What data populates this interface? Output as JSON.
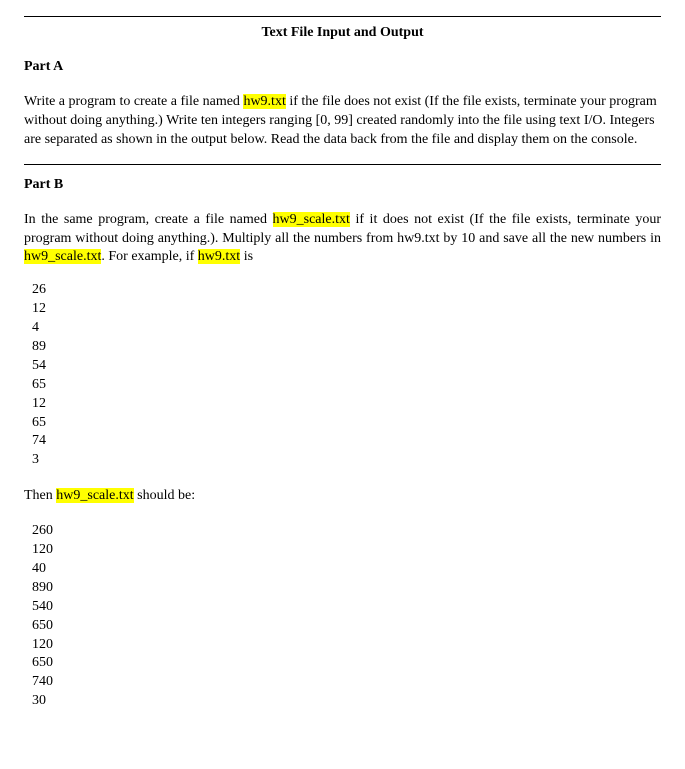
{
  "title": "Text File Input and Output",
  "partA": {
    "heading": "Part A",
    "p1_a": "Write a program to create a file named ",
    "p1_hl1": "hw9.txt",
    "p1_b": " if the file does not exist (If the file exists, terminate your program without doing anything.)  Write ten integers ranging [0, 99] created randomly into the file using text I/O.   Integers are separated as shown in the output below.   Read the data back from the file and display them on the console."
  },
  "partB": {
    "heading": "Part B",
    "p1_a": "In the same program, create a file named ",
    "p1_hl1": "hw9_scale.txt",
    "p1_b": " if it does not exist (If the file exists, terminate your program without doing anything.).  Multiply all the numbers from hw9.txt by 10 and save all the new numbers in ",
    "p1_hl2": "hw9_scale.txt",
    "p1_c": ".  For example, if ",
    "p1_hl3": "hw9.txt",
    "p1_d": " is",
    "example_input": [
      "26",
      "12",
      "4",
      "89",
      "54",
      "65",
      "12",
      "65",
      "74",
      "3"
    ],
    "then_a": "Then ",
    "then_hl": "hw9_scale.txt",
    "then_b": " should be:",
    "example_output": [
      "260",
      "120",
      "40",
      "890",
      "540",
      "650",
      "120",
      "650",
      "740",
      "30"
    ]
  }
}
